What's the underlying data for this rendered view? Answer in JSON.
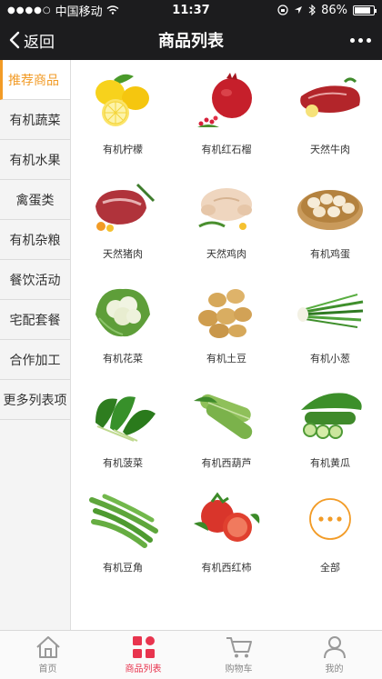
{
  "status_bar": {
    "carrier": "中国移动",
    "time": "11:37",
    "battery": "86%",
    "battery_level": 0.86
  },
  "nav": {
    "back_label": "返回",
    "title": "商品列表"
  },
  "sidebar": {
    "items": [
      {
        "label": "推荐商品"
      },
      {
        "label": "有机蔬菜"
      },
      {
        "label": "有机水果"
      },
      {
        "label": "禽蛋类"
      },
      {
        "label": "有机杂粮"
      },
      {
        "label": "餐饮活动"
      },
      {
        "label": "宅配套餐"
      },
      {
        "label": "合作加工"
      },
      {
        "label": "更多列表项"
      }
    ]
  },
  "products": [
    {
      "label": "有机柠檬",
      "icon": "lemon-icon"
    },
    {
      "label": "有机红石榴",
      "icon": "pomegranate-icon"
    },
    {
      "label": "天然牛肉",
      "icon": "beef-icon"
    },
    {
      "label": "天然猪肉",
      "icon": "pork-icon"
    },
    {
      "label": "天然鸡肉",
      "icon": "chicken-icon"
    },
    {
      "label": "有机鸡蛋",
      "icon": "eggs-icon"
    },
    {
      "label": "有机花菜",
      "icon": "cauliflower-icon"
    },
    {
      "label": "有机土豆",
      "icon": "potato-icon"
    },
    {
      "label": "有机小葱",
      "icon": "scallion-icon"
    },
    {
      "label": "有机菠菜",
      "icon": "spinach-icon"
    },
    {
      "label": "有机西葫芦",
      "icon": "zucchini-icon"
    },
    {
      "label": "有机黄瓜",
      "icon": "cucumber-icon"
    },
    {
      "label": "有机豆角",
      "icon": "green-bean-icon"
    },
    {
      "label": "有机西红柿",
      "icon": "tomato-icon"
    },
    {
      "label": "全部",
      "icon": "more-dots-icon"
    }
  ],
  "tabbar": {
    "items": [
      {
        "label": "首页",
        "icon": "home-icon"
      },
      {
        "label": "商品列表",
        "icon": "grid-icon"
      },
      {
        "label": "购物车",
        "icon": "cart-icon"
      },
      {
        "label": "我的",
        "icon": "user-icon"
      }
    ]
  },
  "colors": {
    "accent_orange": "#f29b26",
    "tab_active": "#e8344e",
    "nav_bg": "#1c1c1e"
  }
}
